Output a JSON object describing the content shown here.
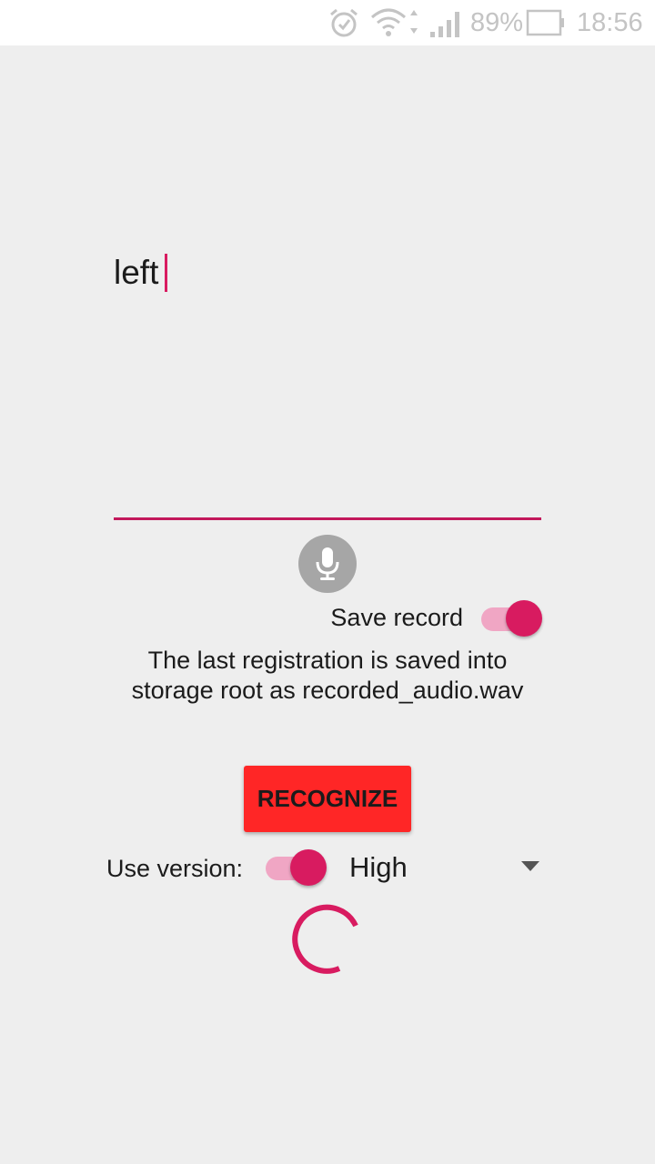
{
  "status_bar": {
    "battery_percent": "89%",
    "time": "18:56",
    "icons": [
      "alarm-icon",
      "wifi-icon",
      "signal-icon",
      "battery-icon"
    ]
  },
  "editor": {
    "text": "left"
  },
  "save_record": {
    "label": "Save record",
    "enabled": true
  },
  "info": {
    "line1": "The last registration is saved into",
    "line2": "storage root as recorded_audio.wav"
  },
  "recognize_button": {
    "label": "RECOGNIZE"
  },
  "version": {
    "label": "Use version:",
    "enabled": true,
    "selected": "High"
  },
  "colors": {
    "accent": "#d81b60",
    "button": "#ff2626",
    "background": "#eeeeee"
  }
}
